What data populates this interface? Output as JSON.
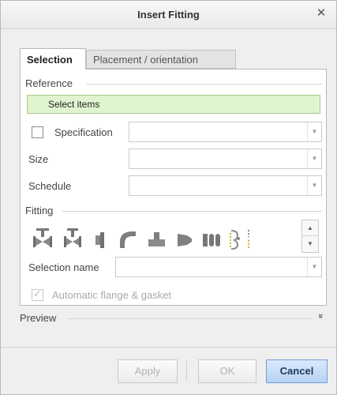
{
  "window": {
    "title": "Insert Fitting",
    "close_icon": "close-icon"
  },
  "tabs": [
    {
      "label": "Selection",
      "active": true
    },
    {
      "label": "Placement / orientation",
      "active": false
    }
  ],
  "reference": {
    "group_label": "Reference",
    "select_items_text": "Select items"
  },
  "specification": {
    "label": "Specification",
    "checked": false,
    "value": ""
  },
  "size": {
    "label": "Size",
    "value": ""
  },
  "schedule": {
    "label": "Schedule",
    "value": ""
  },
  "fitting": {
    "group_label": "Fitting",
    "icons": [
      "gate-valve-icon",
      "globe-valve-icon",
      "flange-icon",
      "elbow-icon",
      "tee-icon",
      "reducer-icon",
      "coupling-icon",
      "gasket-icon",
      "partial-fitting-icon"
    ]
  },
  "selection_name": {
    "label": "Selection name",
    "value": ""
  },
  "auto_flange": {
    "label": "Automatic flange & gasket",
    "checked": true,
    "enabled": false
  },
  "preview": {
    "label": "Preview"
  },
  "buttons": {
    "apply": "Apply",
    "ok": "OK",
    "cancel": "Cancel"
  },
  "colors": {
    "select_items_bg": "#dff5cf",
    "cancel_accent": "#b7d2f3"
  }
}
